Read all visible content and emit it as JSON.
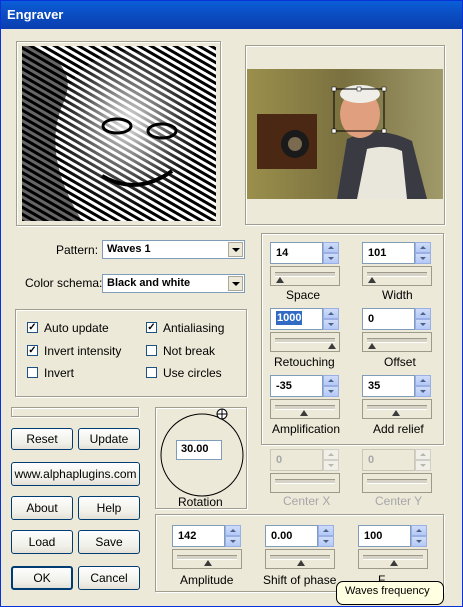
{
  "window": {
    "title": "Engraver"
  },
  "pattern": {
    "label": "Pattern:",
    "value": "Waves 1"
  },
  "color_schema": {
    "label": "Color schema:",
    "value": "Black and white"
  },
  "options": {
    "auto_update": {
      "label": "Auto update",
      "checked": true
    },
    "antialiasing": {
      "label": "Antialiasing",
      "checked": true
    },
    "invert_intensity": {
      "label": "Invert intensity",
      "checked": true
    },
    "not_break": {
      "label": "Not break",
      "checked": false
    },
    "invert": {
      "label": "Invert",
      "checked": false
    },
    "use_circles": {
      "label": "Use circles",
      "checked": false
    }
  },
  "buttons": {
    "reset": "Reset",
    "update": "Update",
    "website": "www.alphaplugins.com",
    "about": "About",
    "help": "Help",
    "load": "Load",
    "save": "Save",
    "ok": "OK",
    "cancel": "Cancel"
  },
  "rotation": {
    "label": "Rotation",
    "value": "30.00"
  },
  "params": {
    "space": {
      "label": "Space",
      "value": "14"
    },
    "width": {
      "label": "Width",
      "value": "101"
    },
    "retouching": {
      "label": "Retouching",
      "value": "1000"
    },
    "offset": {
      "label": "Offset",
      "value": "0"
    },
    "amplification": {
      "label": "Amplification",
      "value": "-35"
    },
    "add_relief": {
      "label": "Add relief",
      "value": "35"
    },
    "center_x": {
      "label": "Center X",
      "value": "0"
    },
    "center_y": {
      "label": "Center Y",
      "value": "0"
    },
    "amplitude": {
      "label": "Amplitude",
      "value": "142"
    },
    "shift_of_phase": {
      "label": "Shift of phase",
      "value": "0.00"
    },
    "waves_frequency": {
      "label": "F",
      "value": "100"
    }
  },
  "tooltip": {
    "text": "Waves frequency"
  },
  "colors": {
    "title_bar": "#0a5fd8",
    "dialog_bg": "#ece9d8",
    "tooltip_bg": "#ffffe1"
  }
}
